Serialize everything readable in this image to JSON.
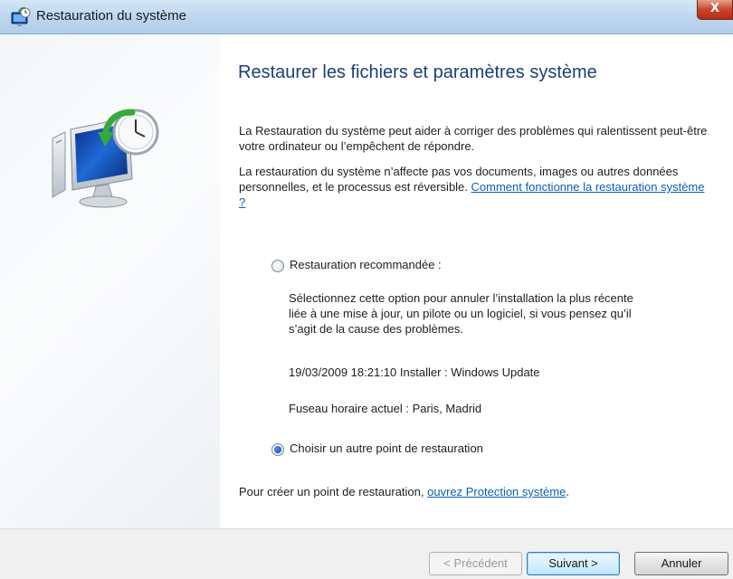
{
  "window": {
    "title": "Restauration du système",
    "close_glyph": "X"
  },
  "main": {
    "heading": "Restaurer les fichiers et paramètres système",
    "intro_1": "La Restauration du système peut aider à corriger des problèmes qui ralentissent peut-être votre ordinateur ou l’empêchent de répondre.",
    "intro_2_text": "La restauration du système n’affecte pas vos documents, images ou autres données personnelles, et le processus est réversible.",
    "intro_2_link": "Comment fonctionne la restauration système ?",
    "options": {
      "recommended": {
        "label": "Restauration recommandée :",
        "checked": false,
        "description": "Sélectionnez cette option pour annuler l’installation la plus récente liée à une mise à jour, un pilote ou un logiciel, si vous pensez qu’il s’agit de la cause des problèmes.",
        "point": "19/03/2009 18:21:10 Installer : Windows Update",
        "timezone": "Fuseau horaire actuel : Paris, Madrid"
      },
      "other": {
        "label": "Choisir un autre point de restauration",
        "checked": true
      }
    },
    "create_point_text": "Pour créer un point de restauration, ",
    "create_point_link": "ouvrez Protection système",
    "create_point_end": "."
  },
  "footer": {
    "back_label": "< Précédent",
    "next_label": "Suivant >",
    "cancel_label": "Annuler"
  },
  "icons": {
    "app": "system-restore-icon",
    "illustration": "computer-restore-clock-icon"
  },
  "colors": {
    "heading": "#1a3f75",
    "link": "#0b5fb4",
    "close": "#c8452b"
  }
}
